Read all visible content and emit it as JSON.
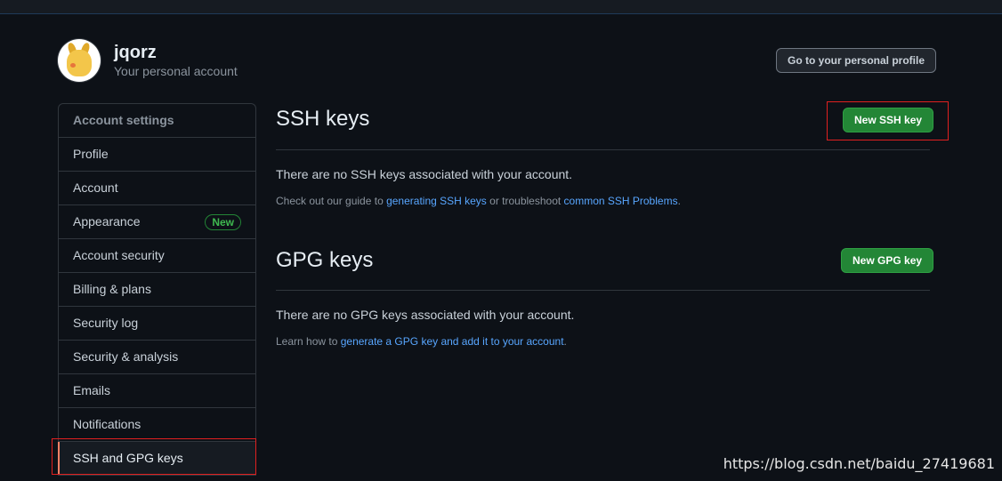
{
  "profile": {
    "username": "jqorz",
    "subtitle": "Your personal account",
    "go_profile_button": "Go to your personal profile"
  },
  "sidebar": {
    "header": "Account settings",
    "items": [
      {
        "label": "Profile"
      },
      {
        "label": "Account"
      },
      {
        "label": "Appearance",
        "badge": "New"
      },
      {
        "label": "Account security"
      },
      {
        "label": "Billing & plans"
      },
      {
        "label": "Security log"
      },
      {
        "label": "Security & analysis"
      },
      {
        "label": "Emails"
      },
      {
        "label": "Notifications"
      },
      {
        "label": "SSH and GPG keys",
        "selected": true
      }
    ]
  },
  "ssh": {
    "title": "SSH keys",
    "new_button": "New SSH key",
    "empty_text": "There are no SSH keys associated with your account.",
    "guide_prefix": "Check out our guide to ",
    "guide_link1": "generating SSH keys",
    "guide_middle": " or troubleshoot ",
    "guide_link2": "common SSH Problems",
    "guide_suffix": "."
  },
  "gpg": {
    "title": "GPG keys",
    "new_button": "New GPG key",
    "empty_text": "There are no GPG keys associated with your account.",
    "learn_prefix": "Learn how to ",
    "learn_link": "generate a GPG key and add it to your account",
    "learn_suffix": "."
  },
  "watermark": "https://blog.csdn.net/baidu_27419681",
  "colors": {
    "background": "#0d1117",
    "link": "#58a6ff",
    "green_button": "#238636",
    "highlight_box": "#e02020"
  }
}
